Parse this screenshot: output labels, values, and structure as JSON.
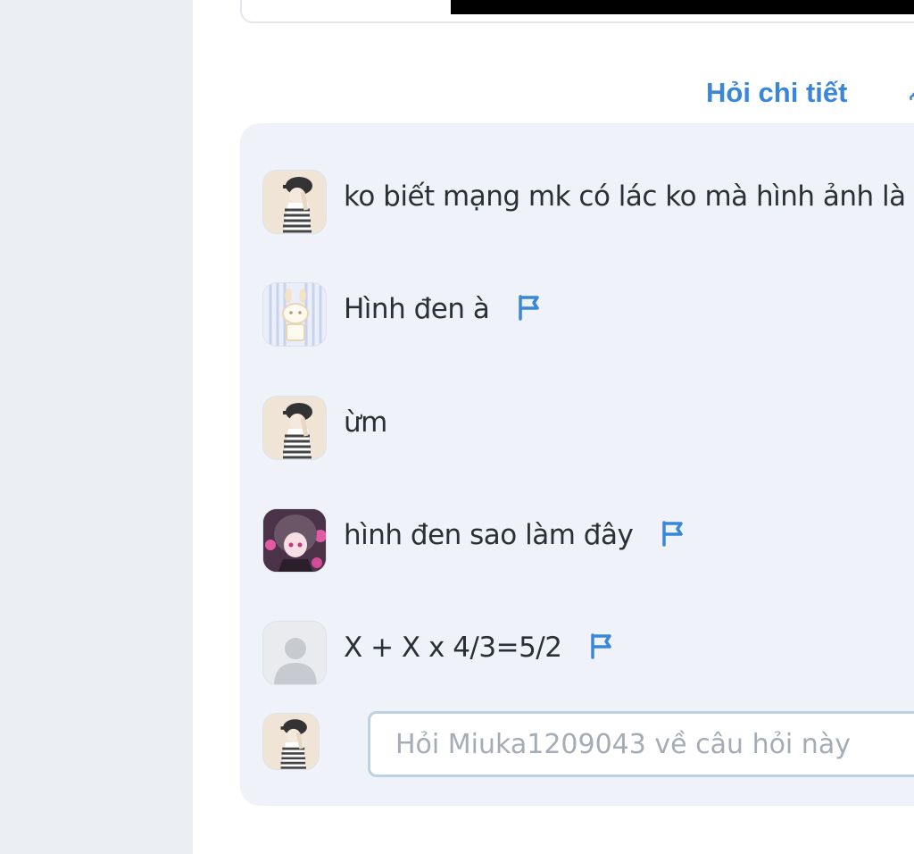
{
  "answer_card": {
    "image_state": "black"
  },
  "actions": {
    "ask_detail_label": "Hỏi chi tiết"
  },
  "comments": [
    {
      "avatar": "avatar-girl-cap-striped",
      "text": "ko biết mạng mk có lác ko mà hình ảnh là",
      "has_flag": false
    },
    {
      "avatar": "avatar-bunny-blue-stripes",
      "text": "Hình đen à",
      "has_flag": true
    },
    {
      "avatar": "avatar-girl-cap-striped",
      "text": "ừm",
      "has_flag": false
    },
    {
      "avatar": "avatar-anime-girl-pink",
      "text": "hình đen sao làm đây",
      "has_flag": true
    },
    {
      "avatar": "avatar-default-user",
      "text": "X + X x 4/3=5/2",
      "has_flag": true
    }
  ],
  "composer": {
    "avatar": "avatar-girl-cap-striped",
    "placeholder": "Hỏi Miuka1209043 về câu hỏi này"
  },
  "colors": {
    "accent": "#3a86d8",
    "panel_bg": "#eff2f8",
    "rail_bg": "#ebeef2",
    "input_border": "#b9d3e4"
  }
}
